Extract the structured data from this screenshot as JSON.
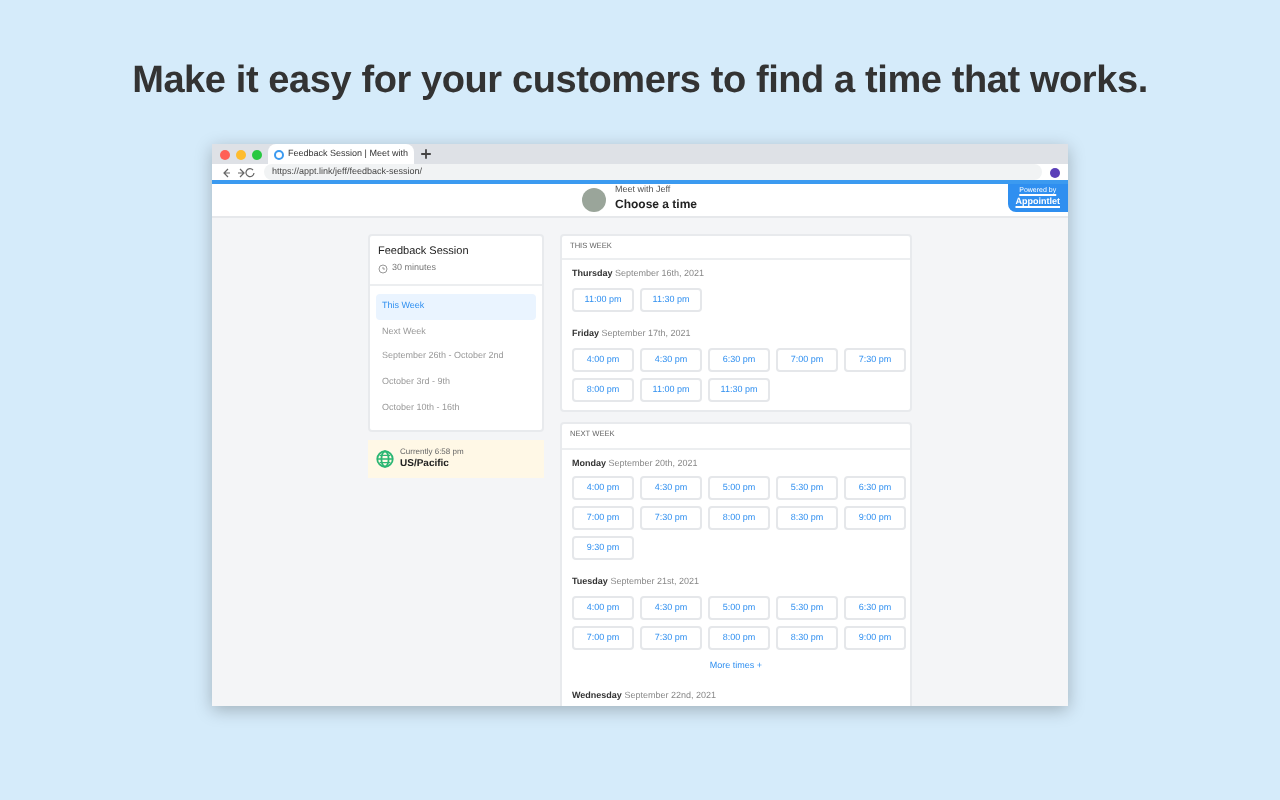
{
  "headline": "Make it easy for your customers to find a time that works.",
  "browser": {
    "tab_title": "Feedback Session | Meet with",
    "url": "https://appt.link/jeff/feedback-session/"
  },
  "header": {
    "host": "Meet with Jeff",
    "title": "Choose a time",
    "badge_caption": "Powered by",
    "badge_brand": "Appointlet"
  },
  "sidebar": {
    "event": "Feedback Session",
    "duration": "30 minutes",
    "weeks": [
      {
        "label": "This Week",
        "selected": true
      },
      {
        "label": "Next Week",
        "selected": false
      },
      {
        "label": "September 26th - October 2nd",
        "selected": false
      },
      {
        "label": "October 3rd - 9th",
        "selected": false
      },
      {
        "label": "October 10th - 16th",
        "selected": false
      }
    ],
    "timezone": {
      "current": "Currently 6:58 pm",
      "zone": "US/Pacific"
    }
  },
  "sections": [
    {
      "heading": "THIS WEEK",
      "days": [
        {
          "weekday": "Thursday",
          "date": "September 16th, 2021",
          "times": [
            "11:00 pm",
            "11:30 pm"
          ]
        },
        {
          "weekday": "Friday",
          "date": "September 17th, 2021",
          "times": [
            "4:00 pm",
            "4:30 pm",
            "6:30 pm",
            "7:00 pm",
            "7:30 pm",
            "8:00 pm",
            "11:00 pm",
            "11:30 pm"
          ]
        }
      ]
    },
    {
      "heading": "NEXT WEEK",
      "days": [
        {
          "weekday": "Monday",
          "date": "September 20th, 2021",
          "times": [
            "4:00 pm",
            "4:30 pm",
            "5:00 pm",
            "5:30 pm",
            "6:30 pm",
            "7:00 pm",
            "7:30 pm",
            "8:00 pm",
            "8:30 pm",
            "9:00 pm",
            "9:30 pm"
          ]
        },
        {
          "weekday": "Tuesday",
          "date": "September 21st, 2021",
          "times": [
            "4:00 pm",
            "4:30 pm",
            "5:00 pm",
            "5:30 pm",
            "6:30 pm",
            "7:00 pm",
            "7:30 pm",
            "8:00 pm",
            "8:30 pm",
            "9:00 pm"
          ],
          "more": "More times +"
        },
        {
          "weekday": "Wednesday",
          "date": "September 22nd, 2021"
        }
      ]
    }
  ]
}
